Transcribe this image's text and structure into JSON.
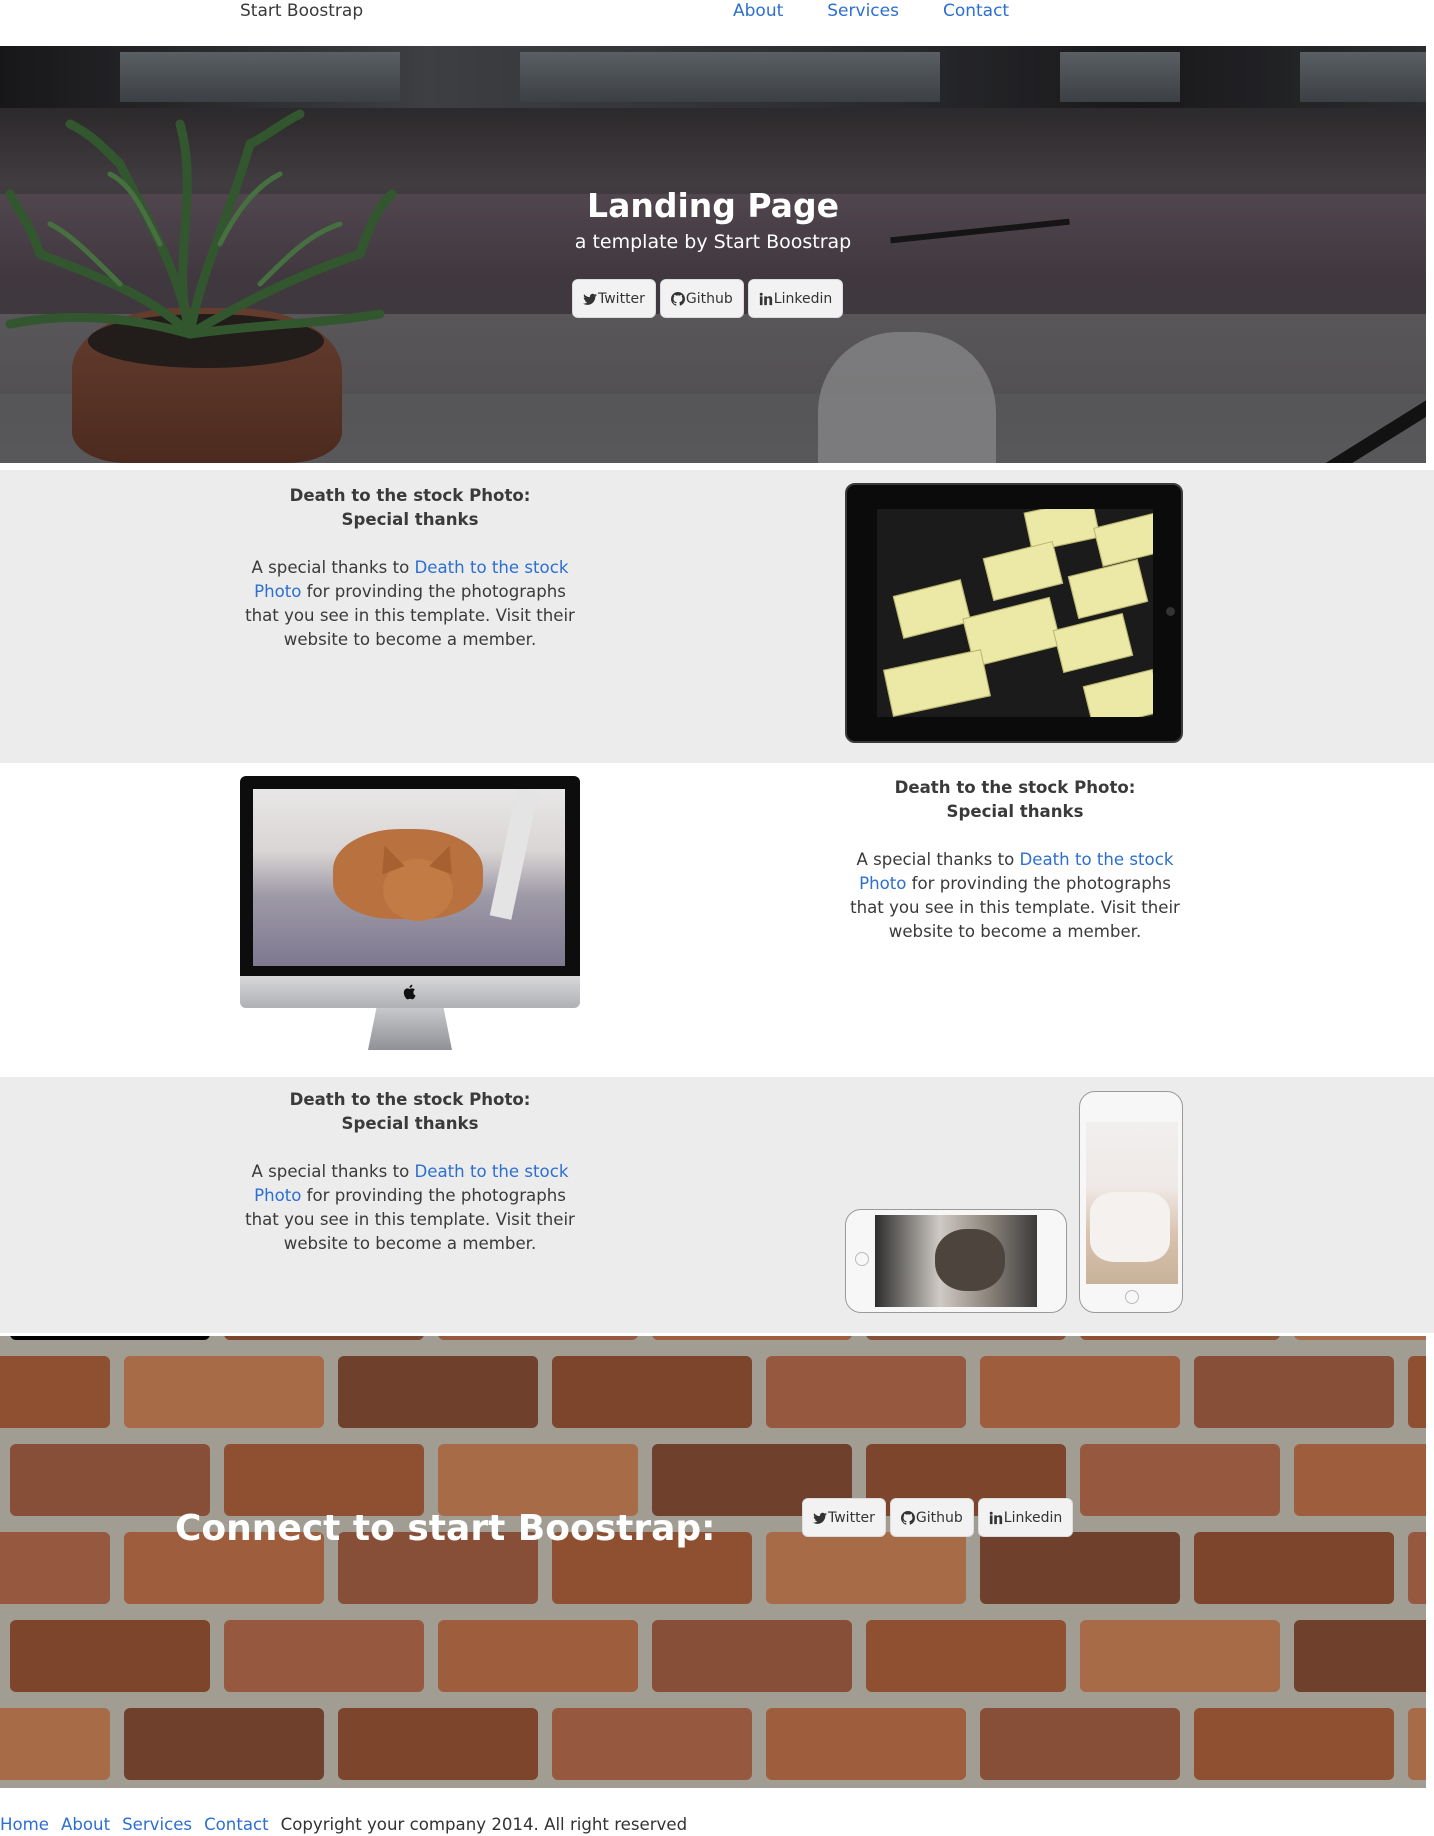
{
  "navbar": {
    "brand": "Start Boostrap",
    "links": [
      {
        "label": "About"
      },
      {
        "label": "Services"
      },
      {
        "label": "Contact"
      }
    ]
  },
  "hero": {
    "title": "Landing Page",
    "subtitle": "a template by Start Boostrap",
    "buttons": [
      {
        "label": "Twitter",
        "icon": "twitter-icon"
      },
      {
        "label": "Github",
        "icon": "github-icon"
      },
      {
        "label": "Linkedin",
        "icon": "linkedin-icon"
      }
    ]
  },
  "sections": [
    {
      "heading_line1": "Death to the stock Photo:",
      "heading_line2": "Special thanks",
      "text_before": "A special thanks to ",
      "link": "Death to the stock Photo",
      "text_after": " for provinding the photographs that you see in this template. Visit their website to become a member.",
      "device": "ipad"
    },
    {
      "heading_line1": "Death to the stock Photo:",
      "heading_line2": "Special thanks",
      "text_before": "A special thanks to ",
      "link": "Death to the stock Photo",
      "text_after": " for provinding the photographs that you see in this template. Visit their website to become a member.",
      "device": "imac"
    },
    {
      "heading_line1": "Death to the stock Photo:",
      "heading_line2": "Special thanks",
      "text_before": "A special thanks to ",
      "link": "Death to the stock Photo",
      "text_after": " for provinding the photographs that you see in this template. Visit their website to become a member.",
      "device": "iphones"
    }
  ],
  "connect": {
    "title": "Connect to start Boostrap:",
    "buttons": [
      {
        "label": "Twitter",
        "icon": "twitter-icon"
      },
      {
        "label": "Github",
        "icon": "github-icon"
      },
      {
        "label": "Linkedin",
        "icon": "linkedin-icon"
      }
    ]
  },
  "footer": {
    "links": [
      {
        "label": "Home"
      },
      {
        "label": "About"
      },
      {
        "label": "Services"
      },
      {
        "label": "Contact"
      }
    ],
    "copyright": "Copyright your company 2014. All right reserved"
  },
  "colors": {
    "link": "#2c6fd1",
    "section_grey": "#ececec",
    "text": "#333333"
  }
}
